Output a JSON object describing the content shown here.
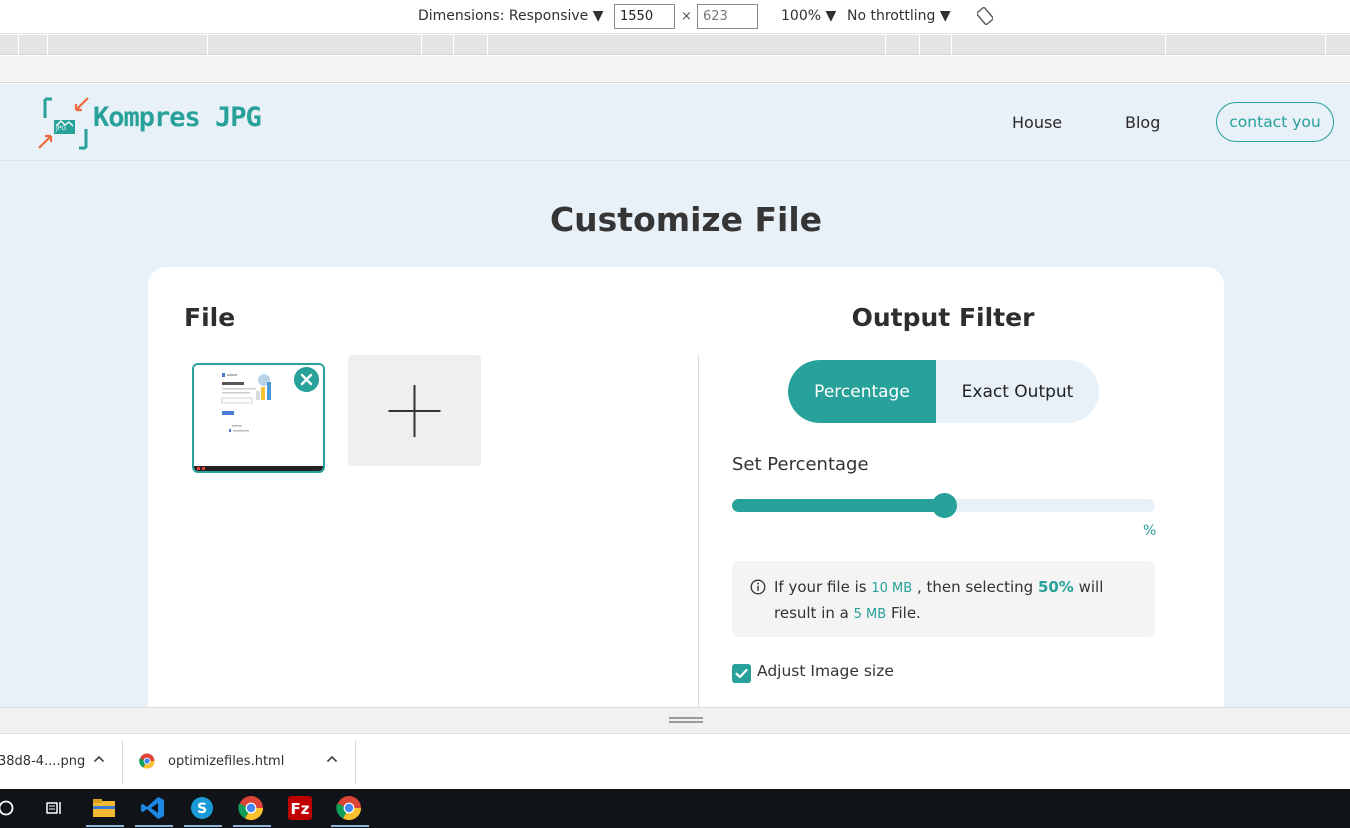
{
  "devtools": {
    "dimensions_label": "Dimensions: Responsive ▼",
    "width_value": "1550",
    "times_symbol": "×",
    "height_placeholder": "623",
    "zoom_label": "100% ▼",
    "throttling_label": "No throttling ▼",
    "rotate_icon": "rotate-icon"
  },
  "site": {
    "logo_text": "Kompres JPG",
    "logo_badge": "JPG",
    "nav": {
      "house": "House",
      "blog": "Blog",
      "contact": "contact you"
    },
    "page_title": "Customize File",
    "accent_color": "#27a199",
    "background_color": "#e8f0f8"
  },
  "file_panel": {
    "heading": "File",
    "remove_icon": "close-icon",
    "add_icon": "plus-icon"
  },
  "output_panel": {
    "heading": "Output Filter",
    "tabs": [
      {
        "label": "Percentage",
        "active": true
      },
      {
        "label": "Exact Output",
        "active": false
      }
    ],
    "set_label": "Set Percentage",
    "slider_value_percent": 50,
    "unit": "%",
    "info": {
      "icon": "info-icon",
      "part1": "If your file is",
      "size_in": "10 MB",
      "part2": ", then selecting",
      "percent": "50%",
      "part3": "will result in a",
      "size_out": "5 MB",
      "part4": "File."
    },
    "checkbox_label": "Adjust Image size",
    "checkbox_checked": true
  },
  "downloads": [
    {
      "name": "38d8-4....png"
    },
    {
      "name": "optimizefiles.html",
      "icon": "chrome-icon"
    }
  ],
  "taskbar": {
    "icons": [
      "search-icon",
      "task-view-icon",
      "file-explorer-icon",
      "vscode-icon",
      "skype-icon",
      "chrome-icon",
      "filezilla-icon",
      "chrome-icon"
    ]
  }
}
